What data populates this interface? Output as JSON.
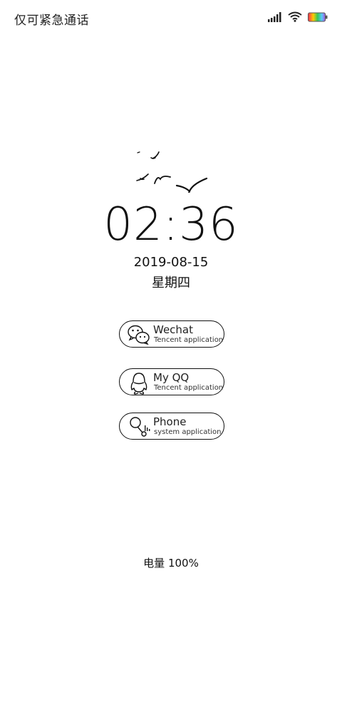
{
  "status_bar": {
    "carrier": "仅可紧急通话",
    "icons": [
      "signal-icon",
      "wifi-icon",
      "battery-icon"
    ]
  },
  "lockscreen": {
    "time": "02:36",
    "date": "2019-08-15",
    "weekday": "星期四"
  },
  "apps": [
    {
      "name": "Wechat",
      "subtitle": "Tencent application",
      "icon": "wechat-icon"
    },
    {
      "name": "My QQ",
      "subtitle": "Tencent application",
      "icon": "qq-icon"
    },
    {
      "name": "Phone",
      "subtitle": "system application",
      "icon": "phone-icon"
    }
  ],
  "battery": {
    "label": "电量 100%",
    "level": 1.0
  },
  "colors": {
    "background": "#ffffff",
    "foreground": "#111111",
    "battery_gradient": [
      "#ff2d55",
      "#ffcc00",
      "#34c759",
      "#5ac8fa",
      "#af52de"
    ]
  }
}
